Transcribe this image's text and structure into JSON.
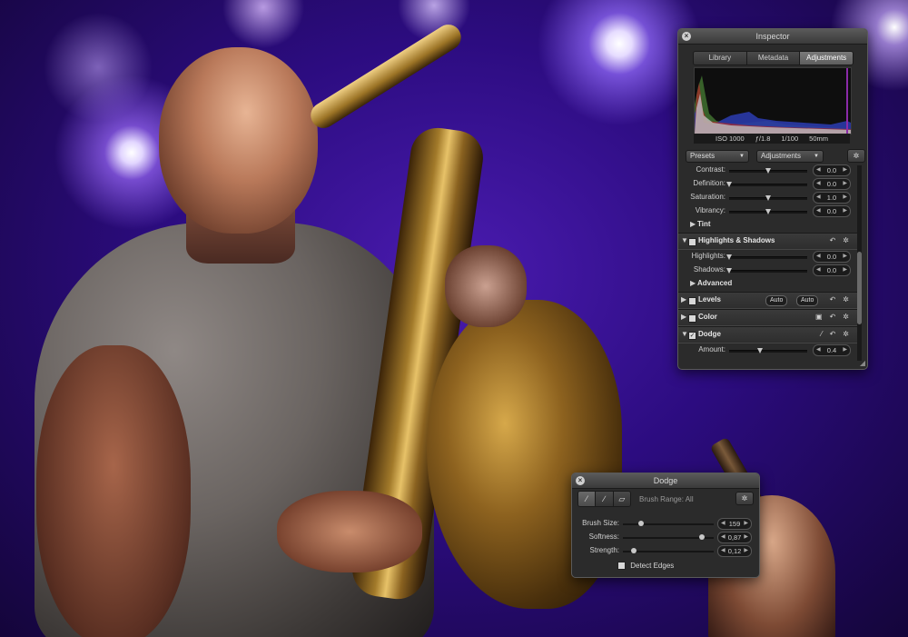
{
  "inspector": {
    "title": "Inspector",
    "tabs": [
      {
        "label": "Library",
        "active": false
      },
      {
        "label": "Metadata",
        "active": false
      },
      {
        "label": "Adjustments",
        "active": true
      }
    ],
    "exif": {
      "iso": "ISO 1000",
      "aperture": "ƒ/1.8",
      "shutter": "1/100",
      "focal": "50mm"
    },
    "presets_label": "Presets",
    "adjustments_label": "Adjustments",
    "enhance_rows": [
      {
        "label": "Contrast:",
        "value": "0.0",
        "level": 0.5
      },
      {
        "label": "Definition:",
        "value": "0.0",
        "level": 0.0
      },
      {
        "label": "Saturation:",
        "value": "1.0",
        "level": 0.5
      },
      {
        "label": "Vibrancy:",
        "value": "0.0",
        "level": 0.5
      }
    ],
    "tint_label": "Tint",
    "highlights_shadows": {
      "title": "Highlights & Shadows",
      "rows": [
        {
          "label": "Highlights:",
          "value": "0.0",
          "level": 0.0
        },
        {
          "label": "Shadows:",
          "value": "0.0",
          "level": 0.0
        }
      ],
      "advanced_label": "Advanced"
    },
    "levels": {
      "title": "Levels",
      "auto1": "Auto",
      "auto2": "Auto"
    },
    "color": {
      "title": "Color"
    },
    "dodge": {
      "title": "Dodge",
      "checked": true,
      "amount_label": "Amount:",
      "amount_value": "0.4",
      "amount_level": 0.4
    }
  },
  "dodge_hud": {
    "title": "Dodge",
    "brush_range": "Brush Range: All",
    "rows": [
      {
        "label": "Brush Size:",
        "value": "159",
        "level": 0.2
      },
      {
        "label": "Softness:",
        "value": "0,87",
        "level": 0.87
      },
      {
        "label": "Strength:",
        "value": "0,12",
        "level": 0.12
      }
    ],
    "detect_edges": "Detect Edges"
  },
  "colors": {
    "panel_bg": "#2b2b2b",
    "accent_purple": "#4a1bb0"
  },
  "icons": {
    "close": "close-icon",
    "gear": "gear-icon",
    "reset": "undo-icon",
    "brush": "brush-icon"
  }
}
